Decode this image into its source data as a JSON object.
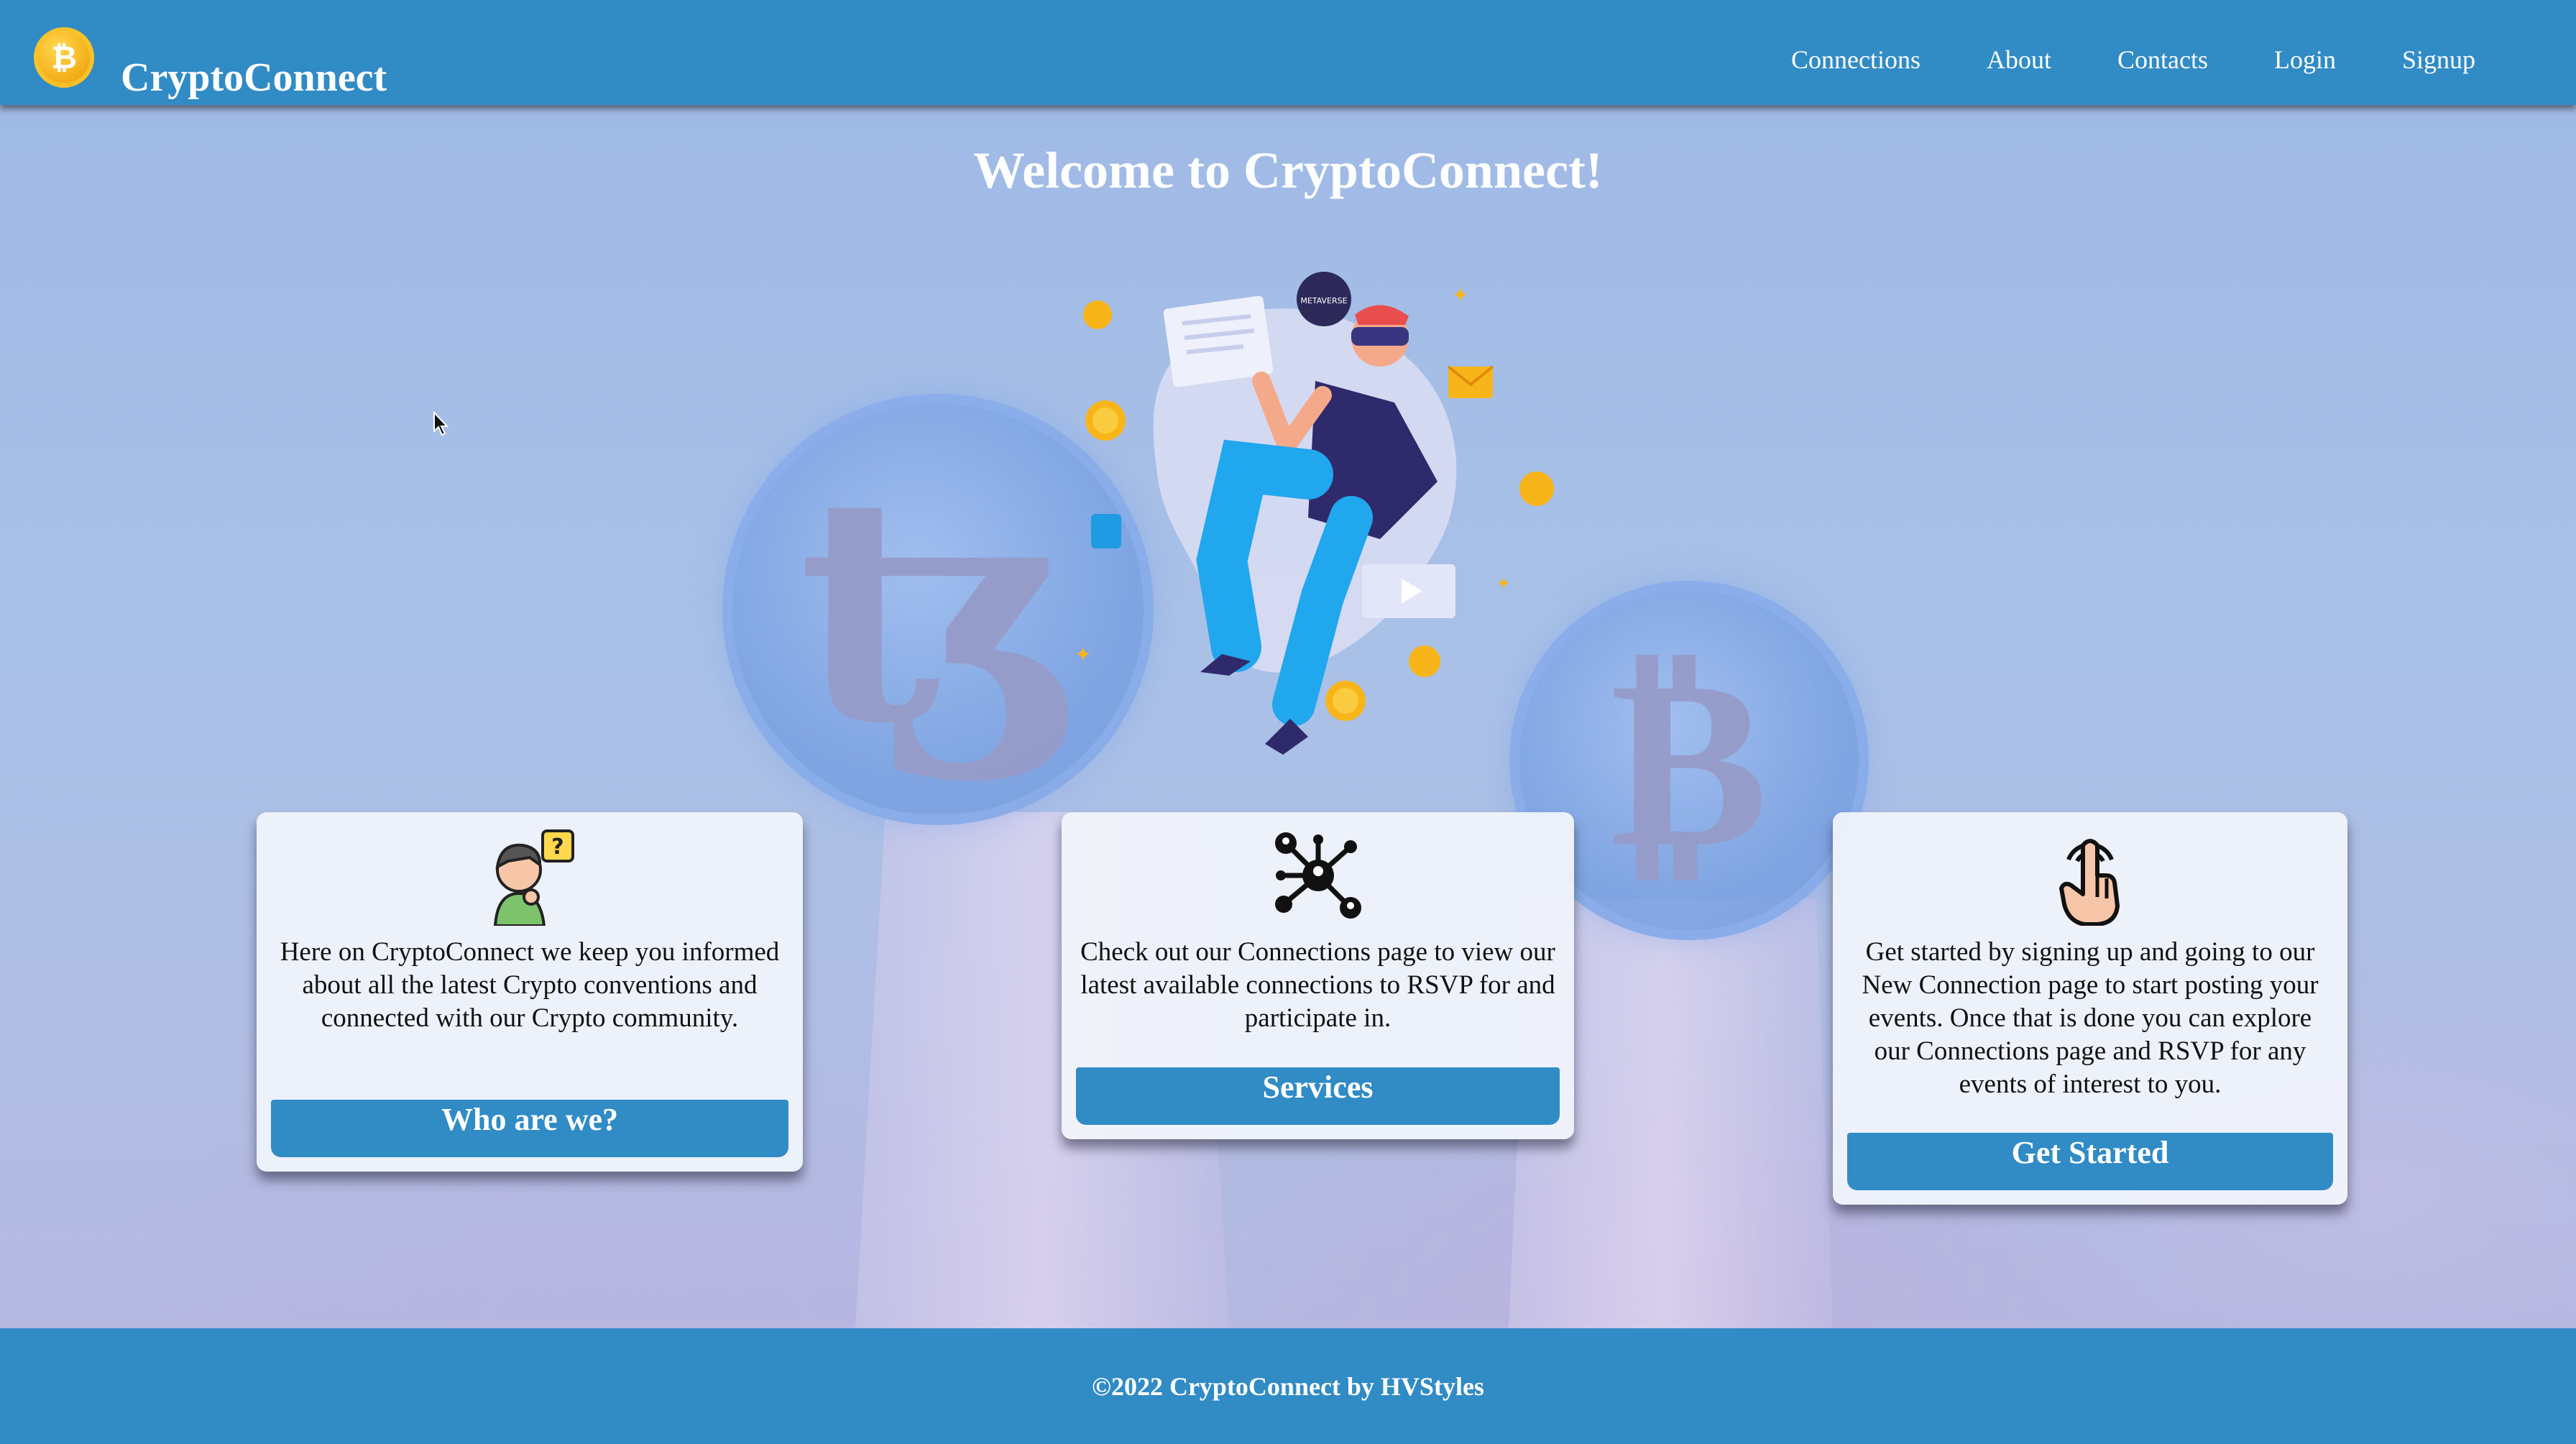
{
  "header": {
    "brand": "CryptoConnect",
    "logo_icon": "bitcoin-coin-icon",
    "logo_glyph": "₿",
    "nav": [
      "Connections",
      "About",
      "Contacts",
      "Login",
      "Signup"
    ]
  },
  "hero": {
    "title": "Welcome to CryptoConnect!",
    "coin_left_glyph": "ꜩ",
    "coin_right_glyph": "₿",
    "illustration_icon": "metaverse-vr-person-illustration",
    "metaverse_label": "METAVERSE"
  },
  "cards": [
    {
      "icon": "thinking-person-question-icon",
      "text": "Here on CryptoConnect we keep you informed about all the latest Crypto conventions and connected with our Crypto community.",
      "button": "Who are we?"
    },
    {
      "icon": "network-connections-icon",
      "text": "Check out our Connections page to view our latest available connections to RSVP for and participate in.",
      "button": "Services"
    },
    {
      "icon": "pointer-hand-touch-icon",
      "text": "Get started by signing up and going to our New Connection page to start posting your events. Once that is done you can explore our Connections page and RSVP for any events of interest to you.",
      "button": "Get Started"
    }
  ],
  "footer": {
    "text": "©2022 CryptoConnect by HVStyles"
  },
  "colors": {
    "primary": "#318bc5",
    "background": "#a7bfe3",
    "card": "#f0f3fa",
    "coin_gold": "#f3a712"
  }
}
